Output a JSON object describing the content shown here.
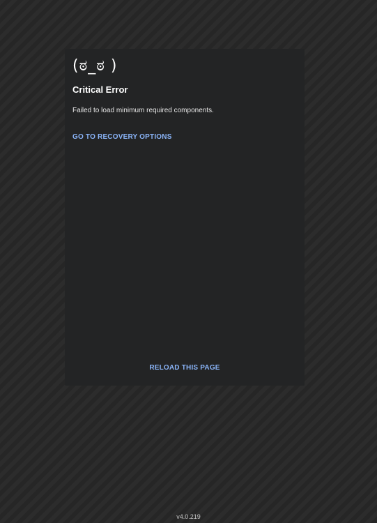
{
  "error_card": {
    "face": "(ಠ_ಠ )",
    "title": "Critical Error",
    "message": "Failed to load minimum required components.",
    "recovery_label": "GO TO RECOVERY OPTIONS",
    "reload_label": "RELOAD THIS PAGE"
  },
  "footer": {
    "version": "v4.0.219"
  },
  "colors": {
    "link": "#8ab4f8",
    "card_bg": "#232425",
    "page_bg": "#2a2a2a"
  }
}
